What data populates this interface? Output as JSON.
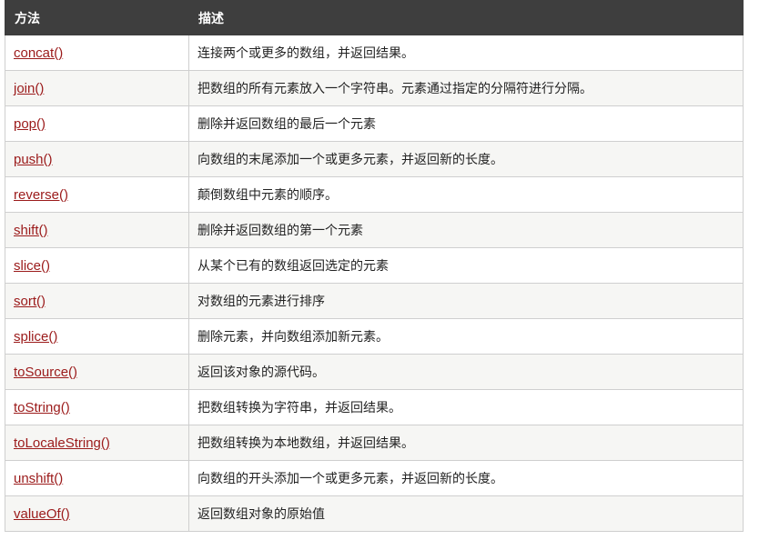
{
  "colors": {
    "header_bg": "#3e3e3e",
    "border": "#cfcfcf",
    "alt_row": "#f6f6f4",
    "link": "#9b1a1a",
    "text": "#222222"
  },
  "table": {
    "headers": {
      "method": "方法",
      "description": "描述"
    },
    "rows": [
      {
        "method": "concat()",
        "description": "连接两个或更多的数组，并返回结果。"
      },
      {
        "method": "join()",
        "description": "把数组的所有元素放入一个字符串。元素通过指定的分隔符进行分隔。"
      },
      {
        "method": "pop()",
        "description": "删除并返回数组的最后一个元素"
      },
      {
        "method": "push()",
        "description": "向数组的末尾添加一个或更多元素，并返回新的长度。"
      },
      {
        "method": "reverse()",
        "description": "颠倒数组中元素的顺序。"
      },
      {
        "method": "shift()",
        "description": "删除并返回数组的第一个元素"
      },
      {
        "method": "slice()",
        "description": "从某个已有的数组返回选定的元素"
      },
      {
        "method": "sort()",
        "description": "对数组的元素进行排序"
      },
      {
        "method": "splice()",
        "description": "删除元素，并向数组添加新元素。"
      },
      {
        "method": "toSource()",
        "description": "返回该对象的源代码。"
      },
      {
        "method": "toString()",
        "description": "把数组转换为字符串，并返回结果。"
      },
      {
        "method": "toLocaleString()",
        "description": "把数组转换为本地数组，并返回结果。"
      },
      {
        "method": "unshift()",
        "description": "向数组的开头添加一个或更多元素，并返回新的长度。"
      },
      {
        "method": "valueOf()",
        "description": "返回数组对象的原始值"
      }
    ]
  }
}
